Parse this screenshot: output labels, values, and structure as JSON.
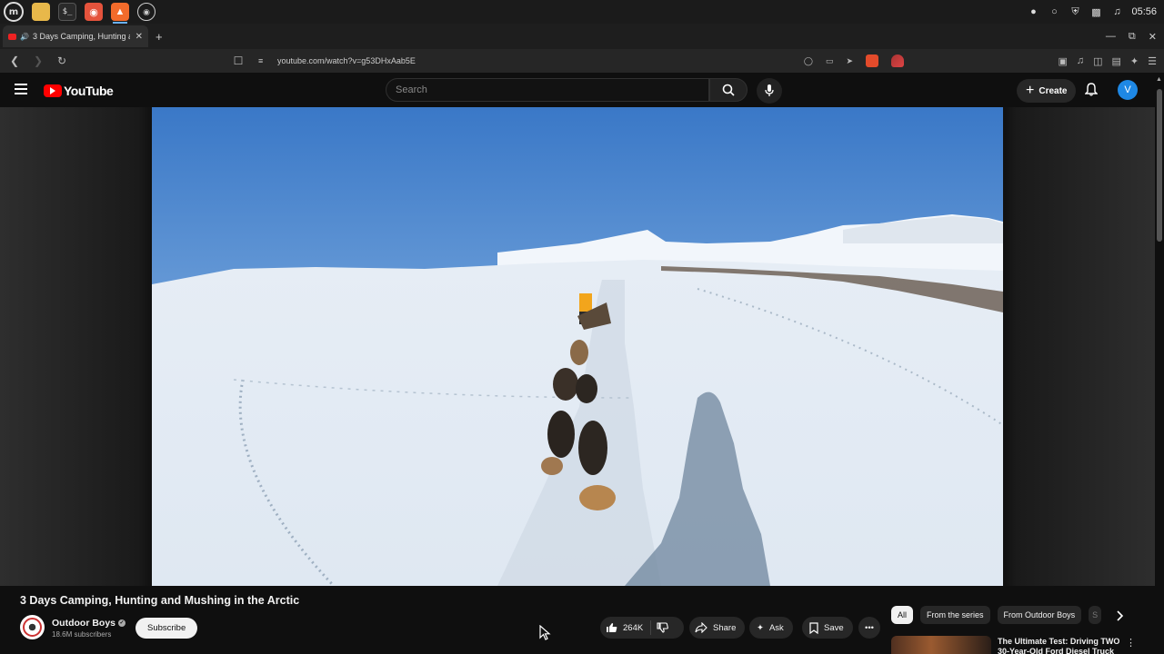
{
  "os": {
    "clock": "05:56",
    "apps": [
      "mint-menu",
      "files",
      "terminal",
      "firefox",
      "brave",
      "steam"
    ]
  },
  "browser": {
    "tab_title": "3 Days Camping, Hunting and Mushing in the Arctic",
    "url": "youtube.com/watch?v=g53DHxAab5E",
    "brave_badge": "3"
  },
  "youtube": {
    "logo_text": "YouTube",
    "search_placeholder": "Search",
    "create_label": "Create",
    "avatar_letter": "V"
  },
  "video": {
    "title": "3 Days Camping, Hunting and Mushing in the Arctic",
    "channel_name": "Outdoor Boys",
    "subscribers": "18.6M subscribers",
    "subscribe_label": "Subscribe",
    "likes": "264K",
    "share_label": "Share",
    "ask_label": "Ask",
    "save_label": "Save"
  },
  "sidebar": {
    "chips": [
      "All",
      "From the series",
      "From Outdoor Boys",
      "S"
    ],
    "active_chip": "All",
    "recommendations": [
      {
        "title": "The Ultimate Test: Driving TWO 30-Year-Old Ford Diesel Truck"
      }
    ]
  },
  "colors": {
    "yt_red": "#ff0000",
    "background": "#0f0f0f",
    "pill": "#272727",
    "avatar": "#1e88e5"
  }
}
